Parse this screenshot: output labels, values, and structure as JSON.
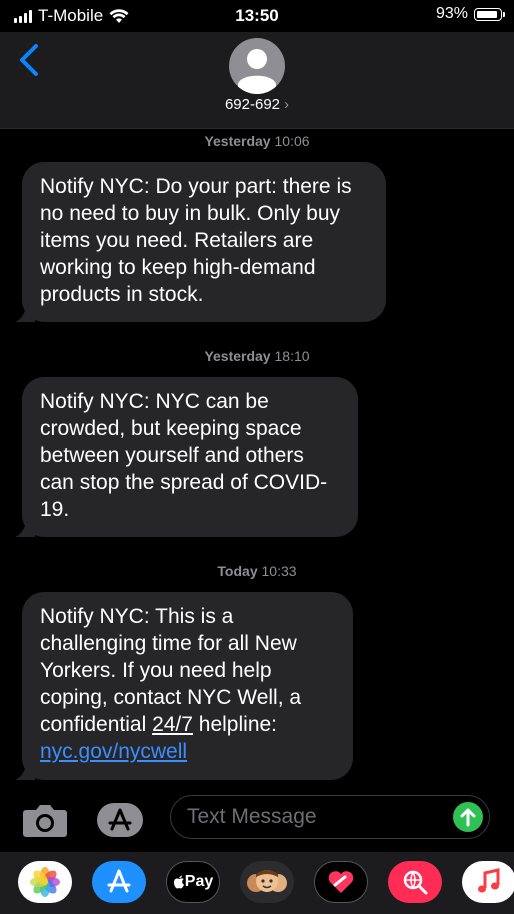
{
  "status_bar": {
    "carrier": "T-Mobile",
    "time": "13:50",
    "battery_percent": "93%",
    "battery_level": 0.93
  },
  "header": {
    "contact_number": "692-692",
    "chevron": "›"
  },
  "messages": [
    {
      "timestamp_day": "Yesterday",
      "timestamp_time": "10:06",
      "text": "Notify NYC: Do your part: there is no need to buy in bulk. Only buy items you need. Retailers are working to keep high-demand products in stock."
    },
    {
      "timestamp_day": "Yesterday",
      "timestamp_time": "18:10",
      "text": "Notify NYC: NYC can be crowded, but keeping space between yourself and others can stop the spread of COVID-19."
    },
    {
      "timestamp_day": "Today",
      "timestamp_time": "10:33",
      "text_before": "Notify NYC: This is a challenging time for all New Yorkers. If you need help coping, contact NYC Well, a confidential ",
      "text_underlined": "24/7",
      "text_after": " helpline: ",
      "link": "nyc.gov/nycwell"
    }
  ],
  "compose": {
    "placeholder": "Text Message"
  },
  "app_tray": {
    "items": [
      "photos-icon",
      "app-store-icon",
      "apple-pay-icon",
      "memoji-icon",
      "digital-touch-icon",
      "web-search-icon",
      "music-icon"
    ],
    "apple_pay_label": "Pay"
  },
  "colors": {
    "bubble": "#262629",
    "link": "#3b8eff",
    "send": "#30c155",
    "accent_blue": "#0a84ff"
  }
}
